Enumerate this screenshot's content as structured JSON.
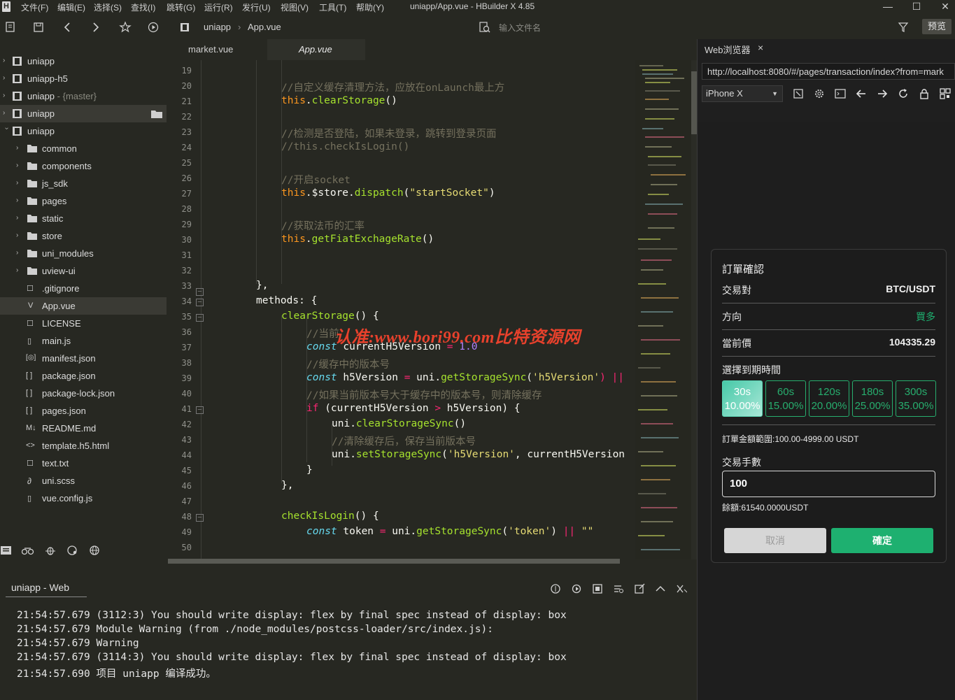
{
  "app": {
    "logo": "H",
    "window_title": "uniapp/App.vue - HBuilder X 4.85",
    "menu": [
      "文件(F)",
      "编辑(E)",
      "选择(S)",
      "查找(I)",
      "跳转(G)",
      "运行(R)",
      "发行(U)",
      "视图(V)",
      "工具(T)",
      "帮助(Y)"
    ],
    "window_controls": {
      "minimize": "—",
      "maximize": "☐",
      "close": "✕"
    }
  },
  "toolbar": {
    "breadcrumb": [
      "uniapp",
      "App.vue"
    ],
    "breadcrumb_sep": "›",
    "file_search_placeholder": "输入文件名",
    "preview_label": "预览"
  },
  "sidebar": {
    "projects": [
      {
        "label": "uniapp",
        "suffix": ""
      },
      {
        "label": "uniapp-h5",
        "suffix": ""
      },
      {
        "label": "uniapp",
        "suffix": " - {master}"
      },
      {
        "label": "uniapp",
        "suffix": ""
      },
      {
        "label": "uniapp",
        "suffix": ""
      }
    ],
    "folders": [
      "common",
      "components",
      "js_sdk",
      "pages",
      "static",
      "store",
      "uni_modules",
      "uview-ui"
    ],
    "files": [
      ".gitignore",
      "App.vue",
      "LICENSE",
      "main.js",
      "manifest.json",
      "package.json",
      "package-lock.json",
      "pages.json",
      "README.md",
      "template.h5.html",
      "text.txt",
      "uni.scss",
      "vue.config.js"
    ],
    "file_glyphs": [
      "☐",
      "V",
      "☐",
      "▯",
      "[◎]",
      "[ ]",
      "[ ]",
      "[ ]",
      "M↓",
      "<>",
      "☐",
      "∂",
      "▯"
    ]
  },
  "tabs": [
    {
      "label": "market.vue"
    },
    {
      "label": "App.vue"
    }
  ],
  "editor": {
    "line_numbers": [
      "19",
      "20",
      "21",
      "22",
      "23",
      "24",
      "25",
      "26",
      "27",
      "28",
      "29",
      "30",
      "31",
      "32",
      "33",
      "34",
      "35",
      "36",
      "37",
      "38",
      "39",
      "40",
      "41",
      "42",
      "43",
      "44",
      "45",
      "46",
      "47",
      "48",
      "49",
      "50"
    ],
    "fold_lines": [
      "33",
      "34",
      "35",
      "41",
      "48"
    ],
    "code": {
      "l20": "//自定义缓存清理方法，应放在onLaunch最上方",
      "l21_this": "this",
      "l21_fn": "clearStorage",
      "l21_rest": "()",
      "l23": "//检测是否登陆，如果未登录，跳转到登录页面",
      "l24": "//this.checkIsLogin()",
      "l26": "//开启socket",
      "l27_this": "this",
      "l27_mid": ".$store.",
      "l27_fn": "dispatch",
      "l27_str": "\"startSocket\"",
      "l29": "//获取法币的汇率",
      "l30_this": "this",
      "l30_fn": "getFiatExchageRate",
      "l33": "},",
      "l34": "methods: {",
      "l35_fn": "clearStorage",
      "l35_rest": "() {",
      "l36": "//当前",
      "l37_kw": "const",
      "l37_var": " currentH5Version ",
      "l37_op": "=",
      "l37_num": " 1.0",
      "l38": "//缓存中的版本号",
      "l39_kw": "const",
      "l39_var": " h5Version ",
      "l39_op": "=",
      "l39_mid": " uni.",
      "l39_fn": "getStorageSync",
      "l39_str": "'h5Version'",
      "l39_tail": ") ||",
      "l40": "//如果当前版本号大于缓存中的版本号，则清除缓存",
      "l41_kw": "if",
      "l41_a": " (currentH5Version ",
      "l41_op": ">",
      "l41_b": " h5Version) {",
      "l42_mid": "uni.",
      "l42_fn": "clearStorageSync",
      "l42_rest": "()",
      "l43": "//清除缓存后，保存当前版本号",
      "l44_mid": "uni.",
      "l44_fn": "setStorageSync",
      "l44_str": "'h5Version'",
      "l44_rest": ", currentH5Version",
      "l45": "}",
      "l46": "},",
      "l48_fn": "checkIsLogin",
      "l48_rest": "() {",
      "l49_kw": "const",
      "l49_var": " token ",
      "l49_op": "=",
      "l49_mid": " uni.",
      "l49_fn": "getStorageSync",
      "l49_str": "'token'",
      "l49_or": "||",
      "l49_empty": "\"\""
    }
  },
  "watermark": "认准:www.bori99.com比特资源网",
  "console": {
    "tab_label": "uniapp - Web",
    "lines": [
      "21:54:57.679 (3112:3) You should write display: flex by final spec instead of display: box",
      "21:54:57.679 Module Warning (from ./node_modules/postcss-loader/src/index.js):",
      "21:54:57.679 Warning",
      "21:54:57.679 (3114:3) You should write display: flex by final spec instead of display: box",
      "21:54:57.690 项目 uniapp 编译成功。"
    ]
  },
  "browser": {
    "tab_label": "Web浏览器",
    "tab_close": "×",
    "url": "http://localhost:8080/#/pages/transaction/index?from=mark",
    "device": "iPhone X"
  },
  "dialog": {
    "title": "訂單確認",
    "pair_label": "交易對",
    "pair_value": "BTC/USDT",
    "direction_label": "方向",
    "direction_value": "買多",
    "price_label": "當前價",
    "price_value": "104335.29",
    "period_label": "選擇到期時間",
    "periods": [
      {
        "time": "30s",
        "rate": "10.00%"
      },
      {
        "time": "60s",
        "rate": "15.00%"
      },
      {
        "time": "120s",
        "rate": "20.00%"
      },
      {
        "time": "180s",
        "rate": "25.00%"
      },
      {
        "time": "300s",
        "rate": "35.00%"
      }
    ],
    "selected_period": 0,
    "range_text": "訂單金額範圍:100.00-4999.00 USDT",
    "fee_label": "交易手數",
    "amount_value": "100",
    "balance_text": "餘額:61540.0000USDT",
    "cancel_label": "取消",
    "confirm_label": "確定"
  },
  "colors": {
    "accent_green": "#1eb070",
    "editor_bg": "#272822",
    "watermark": "#e8412c"
  }
}
